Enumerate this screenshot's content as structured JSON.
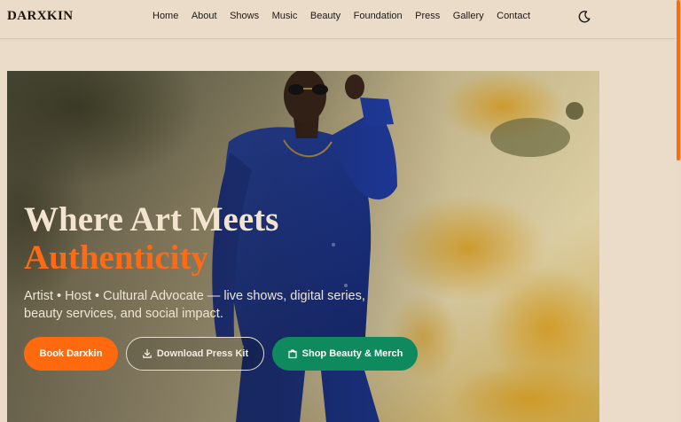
{
  "header": {
    "brand": "DARXKIN",
    "nav": [
      "Home",
      "About",
      "Shows",
      "Music",
      "Beauty",
      "Foundation",
      "Press",
      "Gallery",
      "Contact"
    ],
    "theme_toggle_icon": "moon-icon"
  },
  "hero": {
    "title_line1": "Where Art Meets",
    "title_line2": "Authenticity",
    "subtitle": "Artist • Host • Cultural Advocate — live shows, digital series, beauty services, and social impact.",
    "buttons": {
      "book": "Book Darxkin",
      "press_kit": "Download Press Kit",
      "shop": "Shop Beauty & Merch"
    },
    "icons": {
      "press_kit": "download-icon",
      "shop": "shopping-bag-icon"
    }
  },
  "colors": {
    "page_bg": "#ebdcc9",
    "accent": "#ff6a10",
    "shop_green": "#0f8a5f",
    "title_light": "#f3e4cf",
    "outfit_blue": "#1f3fa6"
  }
}
